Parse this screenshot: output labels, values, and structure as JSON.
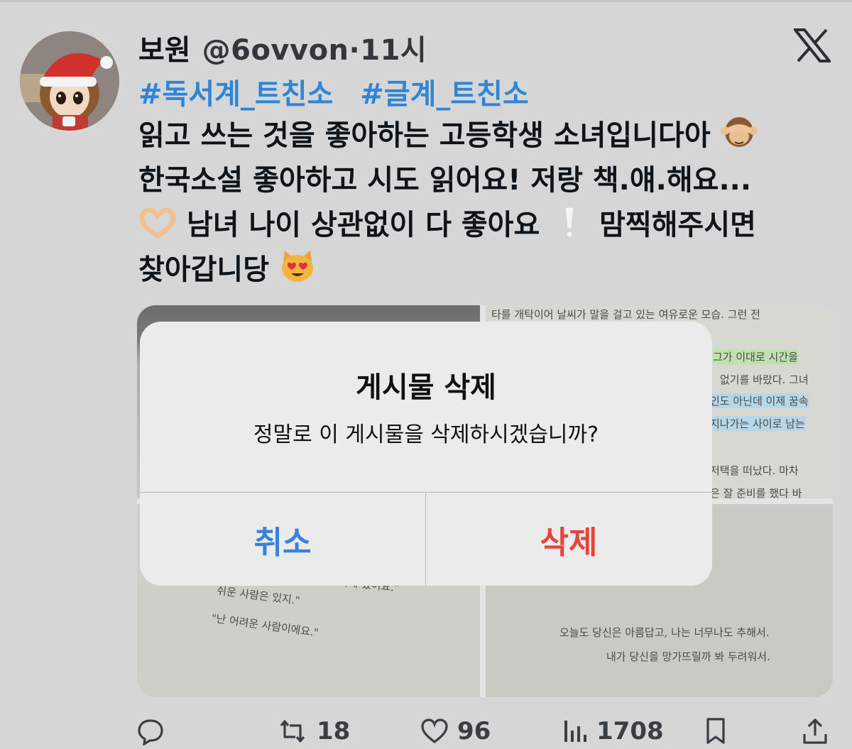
{
  "tweet": {
    "display_name": "보원",
    "handle": "@6ovvon",
    "separator": "·",
    "time": "11시",
    "hashtags": [
      "#독서계_트친소",
      "#글계_트친소"
    ],
    "lines": [
      "읽고 쓰는 것을 좋아하는 고등학생 소녀입니다아",
      "한국소설 좋아하고 시도 읽어요! 저랑 책.얘.해요...",
      "남녀 나이 상관없이 다 좋아요",
      "맘찍해주시면",
      "찾아갑니당"
    ],
    "emoji": [
      "see-no-evil-monkey",
      "heart-hands",
      "exclamation-mark",
      "heart-eyes-cat"
    ]
  },
  "media": {
    "photo2": {
      "lines": [
        "타를 개탁이어 날씨가 말을 걸고 있는 여유로운 모습. 그런 전",
        "그가 이대로 시간을",
        "없기를 바랐다. 그녀",
        "인도 아닌데 이제 꿈속",
        "지나가는 사이로 남는",
        "저택을 떠났다. 마차",
        "은 잘 준비를 했다 바"
      ]
    },
    "photo3": {
      "lines": [
        "어디에 있어요.\"",
        "쉬운 사람은 있지.\"",
        "\"난 어려운 사람이에요.\""
      ]
    },
    "photo4": {
      "lines": [
        "오늘도 당신은 아름답고, 나는 너무나도 추해서.",
        "내가 당신을 망가뜨릴까 봐 두려워서."
      ]
    }
  },
  "dialog": {
    "title": "게시물 삭제",
    "message": "정말로 이 게시물을 삭제하시겠습니까?",
    "cancel_label": "취소",
    "delete_label": "삭제"
  },
  "actions": {
    "retweet_count": "18",
    "like_count": "96",
    "view_count": "1708"
  },
  "colors": {
    "hashtag": "#2f86d6",
    "cancel": "#3a80dc",
    "delete": "#e5443f"
  }
}
